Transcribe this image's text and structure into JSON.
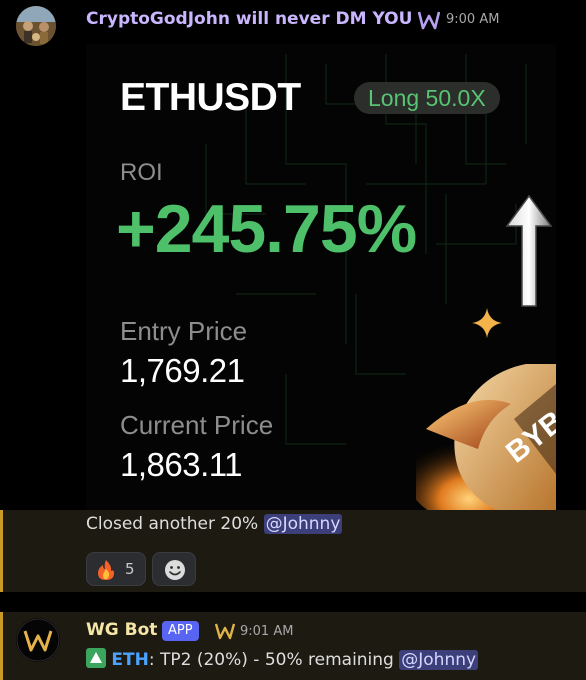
{
  "message1": {
    "username": "CryptoGodJohn will never DM YOU",
    "badge_icon": "w-logo-icon",
    "time": "9:00 AM"
  },
  "card": {
    "pair": "ETHUSDT",
    "leverage": "Long 50.0X",
    "roi_label": "ROI",
    "roi_value": "+245.75%",
    "entry_label": "Entry Price",
    "entry_value": "1,769.21",
    "current_label": "Current Price",
    "current_value": "1,863.11",
    "brand_partial": "BYB",
    "colors": {
      "positive": "#4ec06a",
      "accent": "#f0a23a"
    }
  },
  "followup": {
    "text": "Closed another 20% ",
    "mention": "@Johnny",
    "reaction_emoji": "fire-icon",
    "reaction_count": "5",
    "add_reaction_icon": "smiley-icon"
  },
  "bot_message": {
    "name": "WG Bot",
    "tag": "APP",
    "time": "9:01 AM",
    "icon": "up-arrow-icon",
    "ticker": "ETH",
    "text": ": TP2 (20%) - 50% remaining ",
    "mention": "@Johnny"
  }
}
